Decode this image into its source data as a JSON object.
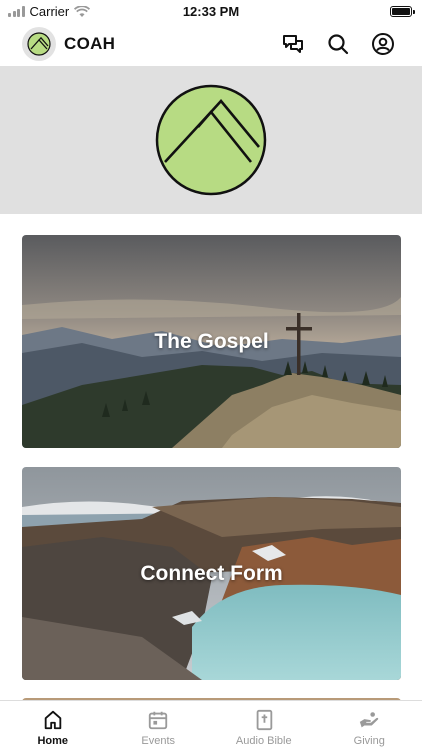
{
  "status_bar": {
    "carrier": "Carrier",
    "time": "12:33 PM"
  },
  "header": {
    "app_name": "COAH"
  },
  "colors": {
    "brand_green": "#b7db83",
    "banner_bg": "#e0e0e0"
  },
  "cards": [
    {
      "title": "The Gospel"
    },
    {
      "title": "Connect Form"
    }
  ],
  "tabbar": {
    "items": [
      {
        "label": "Home",
        "icon": "home-icon",
        "active": true
      },
      {
        "label": "Events",
        "icon": "calendar-icon",
        "active": false
      },
      {
        "label": "Audio Bible",
        "icon": "bible-icon",
        "active": false
      },
      {
        "label": "Giving",
        "icon": "giving-hand-icon",
        "active": false
      }
    ]
  }
}
